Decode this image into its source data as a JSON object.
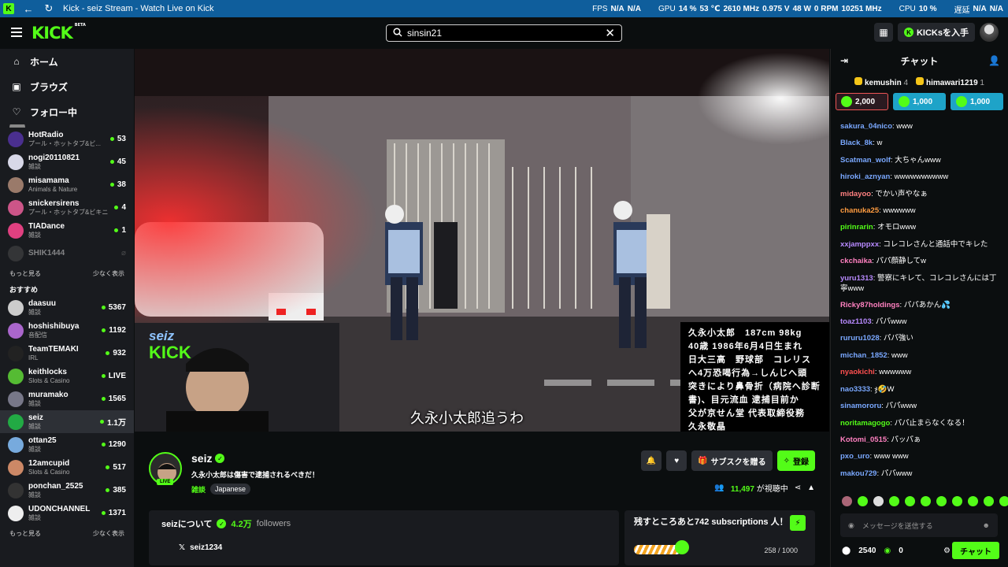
{
  "titlebar": {
    "title": "Kick - seiz Stream - Watch Live on Kick"
  },
  "hud": {
    "fps_label": "FPS",
    "fps1": "N/A",
    "fps2": "N/A",
    "gpu_label": "GPU",
    "gpu_pct": "14 %",
    "gpu_temp": "53 ℃",
    "gpu_mhz": "2610 MHz",
    "gpu_v": "0.975 V",
    "gpu_w": "48 W",
    "gpu_rpm": "0 RPM",
    "gpu_mhz2": "10251 MHz",
    "cpu_label": "CPU",
    "cpu_pct": "10 %",
    "delay_label": "遅延",
    "d1": "N/A",
    "d2": "N/A"
  },
  "header": {
    "logo": "KICK",
    "logo_badge": "BETA",
    "search_value": "sinsin21",
    "kicks_button": "KICKsを入手"
  },
  "sidebar": {
    "nav": [
      {
        "label": "ホーム",
        "icon": "⌂"
      },
      {
        "label": "ブラウズ",
        "icon": "▣"
      },
      {
        "label": "フォロー中",
        "icon": "♡"
      }
    ],
    "following": [
      {
        "name": "HotRadio",
        "cat": "プール・ホットタブ&ビ...",
        "viewers": "53",
        "color": "#4a2f8f"
      },
      {
        "name": "nogi20110821",
        "cat": "雑談",
        "viewers": "45",
        "color": "#d8d8e8"
      },
      {
        "name": "misamama",
        "cat": "Animals & Nature",
        "viewers": "38",
        "color": "#9a7a6a"
      },
      {
        "name": "snickersirens",
        "cat": "プール・ホットタブ&ビキニ",
        "viewers": "4",
        "color": "#c58"
      },
      {
        "name": "TIADance",
        "cat": "雑談",
        "viewers": "1",
        "color": "#e04080"
      },
      {
        "name": "SHIK1444",
        "cat": "",
        "viewers": "",
        "color": "#555",
        "off": true
      }
    ],
    "show_more": "もっと見る",
    "show_less": "少なく表示",
    "recommended_title": "おすすめ",
    "recommended": [
      {
        "name": "daasuu",
        "cat": "雑談",
        "viewers": "5367",
        "color": "#ccc"
      },
      {
        "name": "hoshishibuya",
        "cat": "音配信",
        "viewers": "1192",
        "color": "#a6c"
      },
      {
        "name": "TeamTEMAKI",
        "cat": "IRL",
        "viewers": "932",
        "color": "#222"
      },
      {
        "name": "keithlocks",
        "cat": "Slots & Casino",
        "viewers": "LIVE",
        "color": "#5b3"
      },
      {
        "name": "muramako",
        "cat": "雑談",
        "viewers": "1565",
        "color": "#778"
      },
      {
        "name": "seiz",
        "cat": "雑談",
        "viewers": "1.1万",
        "color": "#2a4",
        "sel": true
      },
      {
        "name": "ottan25",
        "cat": "雑談",
        "viewers": "1290",
        "color": "#7ad"
      },
      {
        "name": "12amcupid",
        "cat": "Slots & Casino",
        "viewers": "517",
        "color": "#c86"
      },
      {
        "name": "ponchan_2525",
        "cat": "雑談",
        "viewers": "385",
        "color": "#333"
      },
      {
        "name": "UDONCHANNEL",
        "cat": "雑談",
        "viewers": "1371",
        "color": "#eee"
      }
    ]
  },
  "video": {
    "caption": "久永小太郎追うわ",
    "bio_lines": [
      "久永小太郎　187cm 98kg",
      "40歳 1986年6月4日生まれ",
      "日大三高　野球部　コレリス",
      "へ4万恐喝行為→しんじへ頭",
      "突きにより鼻骨折（病院へ診断",
      "書)、目元流血 逮捕目前か",
      "父が京せん堂 代表取締役務",
      "久永敬晶"
    ],
    "cam_overlay_text": "seiz",
    "cam_overlay_text2": "KICK"
  },
  "channel": {
    "name": "seiz",
    "title": "久永小太郎は傷害で逮捕されるべきだ！",
    "category": "雑談",
    "language": "Japanese",
    "live": "LIVE",
    "subscribe_gift": "サブスクを贈る",
    "follow": "登録",
    "viewers": "11,497",
    "viewers_label": "が視聴中",
    "about_title": "seizについて",
    "followers": "4.2万",
    "followers_label": "followers",
    "x_handle": "seiz1234",
    "sub_goal_text": "残すところあと742 subscriptions 人！",
    "sub_count": "258 / 1000",
    "sub_progress": 0.258
  },
  "chat": {
    "title": "チャット",
    "top_gifters": [
      {
        "name": "kemushin",
        "count": "4"
      },
      {
        "name": "himawari1219",
        "count": "1"
      }
    ],
    "gifts": [
      {
        "amount": "2,000",
        "bg": "#2a1a20",
        "border": "#e55"
      },
      {
        "amount": "1,000",
        "bg": "#1ea3c8",
        "border": "#1ea3c8"
      },
      {
        "amount": "1,000",
        "bg": "#1ea3c8",
        "border": "#1ea3c8"
      }
    ],
    "messages": [
      {
        "user": "sakura_04nico",
        "text": "www",
        "color": "#7aa8ff"
      },
      {
        "user": "Black_8k",
        "text": "w",
        "color": "#7aa8ff"
      },
      {
        "user": "Scatman_wolf",
        "text": "大ちゃんwww",
        "color": "#7aa8ff"
      },
      {
        "user": "hiroki_aznyan",
        "text": "wwwwwwwwww",
        "color": "#7aa8ff"
      },
      {
        "user": "midayoo",
        "text": "でかい声やなぁ",
        "color": "#ff8080"
      },
      {
        "user": "chanuka25",
        "text": "wwwwww",
        "color": "#ff9c40"
      },
      {
        "user": "pirinrarin",
        "text": "オモロwww",
        "color": "#53fc18"
      },
      {
        "user": "xxjamppxx",
        "text": "コレコレさんと通話中でキレた",
        "color": "#b88aff"
      },
      {
        "user": "ckchaika",
        "text": "パパ顔静してw",
        "color": "#ff80c0"
      },
      {
        "user": "yuru1313",
        "text": "警察にキレて、コレコレさんには丁寧www",
        "color": "#b88aff",
        "wrap": true
      },
      {
        "user": "Ricky87holdings",
        "text": "パパあかん💦",
        "color": "#ff80c0"
      },
      {
        "user": "toaz1103",
        "text": "パパwww",
        "color": "#b88aff"
      },
      {
        "user": "rururu1028",
        "text": "パパ強い",
        "color": "#7aa8ff"
      },
      {
        "user": "michan_1852",
        "text": "www",
        "color": "#7aa8ff"
      },
      {
        "user": "nyaokichi",
        "text": "wwwwww",
        "color": "#ff5050"
      },
      {
        "user": "nao3333",
        "text": "ჯ🤣W",
        "color": "#7aa8ff"
      },
      {
        "user": "sinamororu",
        "text": "パパwww",
        "color": "#7aa8ff"
      },
      {
        "user": "noritamagogo",
        "text": "パパ止まらなくなる！",
        "color": "#53fc18"
      },
      {
        "user": "Kotomi_0515",
        "text": "パッパぁ",
        "color": "#ff80c0"
      },
      {
        "user": "pxo_uro",
        "text": "www www",
        "color": "#7aa8ff"
      },
      {
        "user": "makou729",
        "text": "パパwww",
        "color": "#7aa8ff"
      }
    ],
    "input_placeholder": "メッセージを送信する",
    "points": "2540",
    "kicks": "0",
    "send": "チャット"
  }
}
